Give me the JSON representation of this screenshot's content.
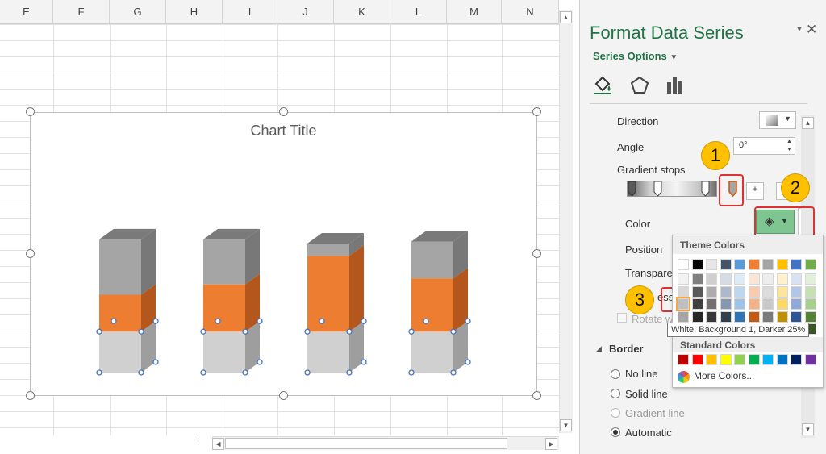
{
  "sheet": {
    "columns": [
      "E",
      "F",
      "G",
      "H",
      "I",
      "J",
      "K",
      "L",
      "M",
      "N"
    ]
  },
  "chart": {
    "title": "Chart Title"
  },
  "chart_data": {
    "type": "bar",
    "title": "Chart Title",
    "categories": [
      "",
      "",
      "",
      ""
    ],
    "series": [
      {
        "values": [
          0.2,
          0.2,
          0.2,
          0.2
        ]
      },
      {
        "values": [
          0.18,
          0.23,
          0.37,
          0.26
        ]
      },
      {
        "values": [
          0.27,
          0.22,
          0.06,
          0.18
        ]
      }
    ],
    "colors": [
      "#d0d0d0",
      "#ed7d31",
      "#a5a5a5"
    ]
  },
  "pane": {
    "title": "Format Data Series",
    "series_options": "Series Options",
    "direction_label": "Direction",
    "angle_label": "Angle",
    "angle_value": "0°",
    "gradient_stops_label": "Gradient stops",
    "color_label": "Color",
    "position_label": "Position",
    "transparency_label": "Transpare",
    "brightness_label": "ess",
    "rotate_label": "Rotate w",
    "border_label": "Border",
    "no_line": "No line",
    "solid_line": "Solid line",
    "gradient_line": "Gradient line",
    "automatic": "Automatic"
  },
  "badges": [
    "1",
    "2",
    "3"
  ],
  "popup": {
    "theme_title": "Theme Colors",
    "standard_title": "Standard Colors",
    "more_colors": "More Colors...",
    "tooltip": "White, Background 1, Darker 25%",
    "theme_top": [
      "#ffffff",
      "#000000",
      "#e7e6e6",
      "#44546a",
      "#5b9bd5",
      "#ed7d31",
      "#a5a5a5",
      "#ffc000",
      "#4472c4",
      "#70ad47"
    ],
    "theme_shades": [
      [
        "#f2f2f2",
        "#7f7f7f",
        "#d0cece",
        "#d6dce4",
        "#deebf6",
        "#fbe5d5",
        "#ededed",
        "#fff2cc",
        "#d9e2f3",
        "#e2efd9"
      ],
      [
        "#d8d8d8",
        "#595959",
        "#aeabab",
        "#adb9ca",
        "#bdd7ee",
        "#f7cbac",
        "#dbdbdb",
        "#fee599",
        "#b4c6e7",
        "#c5e0b3"
      ],
      [
        "#bfbfbf",
        "#3f3f3f",
        "#757070",
        "#8496b0",
        "#9dc3e6",
        "#f4b183",
        "#c9c9c9",
        "#ffd965",
        "#8eaadb",
        "#a8d08d"
      ],
      [
        "#a5a5a5",
        "#262626",
        "#3a3838",
        "#323f4f",
        "#2e75b5",
        "#c55a11",
        "#7b7b7b",
        "#bf9000",
        "#2f5496",
        "#538135"
      ],
      [
        "#7f7f7f",
        "#0c0c0c",
        "#171616",
        "#222a35",
        "#1e4e79",
        "#833c0b",
        "#525252",
        "#7f6000",
        "#1f3864",
        "#375623"
      ]
    ],
    "standard": [
      "#c00000",
      "#ff0000",
      "#ffc000",
      "#ffff00",
      "#92d050",
      "#00b050",
      "#00b0f0",
      "#0070c0",
      "#002060",
      "#7030a0"
    ]
  }
}
